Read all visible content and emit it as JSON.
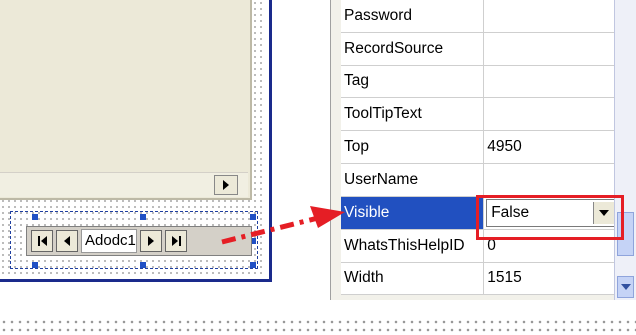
{
  "navigator": {
    "caption": "Adodc1"
  },
  "properties": [
    {
      "name": "Password",
      "value": ""
    },
    {
      "name": "RecordSource",
      "value": ""
    },
    {
      "name": "Tag",
      "value": ""
    },
    {
      "name": "ToolTipText",
      "value": ""
    },
    {
      "name": "Top",
      "value": "4950"
    },
    {
      "name": "UserName",
      "value": ""
    },
    {
      "name": "Visible",
      "value": "False",
      "selected": true
    },
    {
      "name": "WhatsThisHelpID",
      "value": "0"
    },
    {
      "name": "Width",
      "value": "1515"
    }
  ],
  "colors": {
    "selection": "#2150c0",
    "highlight": "#e51e25",
    "form_border": "#1a2a8c"
  },
  "icons": [
    "first-record-icon",
    "previous-record-icon",
    "next-record-icon",
    "last-record-icon",
    "dropdown-arrow-icon",
    "scroll-right-icon",
    "scroll-down-icon"
  ]
}
